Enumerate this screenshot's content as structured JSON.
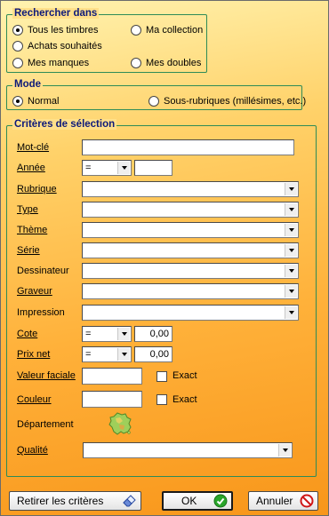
{
  "search_in": {
    "title": "Rechercher dans",
    "options": [
      {
        "label": "Tous les timbres",
        "checked": true
      },
      {
        "label": "Achats souhaités",
        "checked": false
      },
      {
        "label": "Mes manques",
        "checked": false
      },
      {
        "label": "Ma collection",
        "checked": false
      },
      {
        "label": "Mes doubles",
        "checked": false
      }
    ]
  },
  "mode": {
    "title": "Mode",
    "options": [
      {
        "label": "Normal",
        "checked": true
      },
      {
        "label": "Sous-rubriques (millésimes, etc.)",
        "checked": false
      }
    ]
  },
  "criteria": {
    "title": "Critères de sélection",
    "keyword": {
      "label": "Mot-clé",
      "value": ""
    },
    "year": {
      "label": "Année",
      "operator": "=",
      "value": ""
    },
    "rubrique": {
      "label": "Rubrique",
      "value": ""
    },
    "type": {
      "label": "Type",
      "value": ""
    },
    "theme": {
      "label": "Thème",
      "value": ""
    },
    "serie": {
      "label": "Série",
      "value": ""
    },
    "dessinateur": {
      "label": "Dessinateur",
      "value": ""
    },
    "graveur": {
      "label": "Graveur",
      "value": ""
    },
    "impression": {
      "label": "Impression",
      "value": ""
    },
    "cote": {
      "label": "Cote",
      "operator": "=",
      "value": "0,00"
    },
    "prix_net": {
      "label": "Prix net",
      "operator": "=",
      "value": "0,00"
    },
    "valeur_faciale": {
      "label": "Valeur faciale",
      "value": "",
      "exact_label": "Exact",
      "exact": false
    },
    "couleur": {
      "label": "Couleur",
      "value": "",
      "exact_label": "Exact",
      "exact": false
    },
    "departement": {
      "label": "Département",
      "icon": "france-map-icon"
    },
    "qualite": {
      "label": "Qualité",
      "value": ""
    }
  },
  "buttons": {
    "clear": "Retirer les critères",
    "ok": "OK",
    "cancel": "Annuler"
  },
  "colors": {
    "group_border": "#2e8b57",
    "group_title": "#0d1a7a",
    "ok_icon": "#2aa52a",
    "cancel_icon": "#d01818"
  }
}
